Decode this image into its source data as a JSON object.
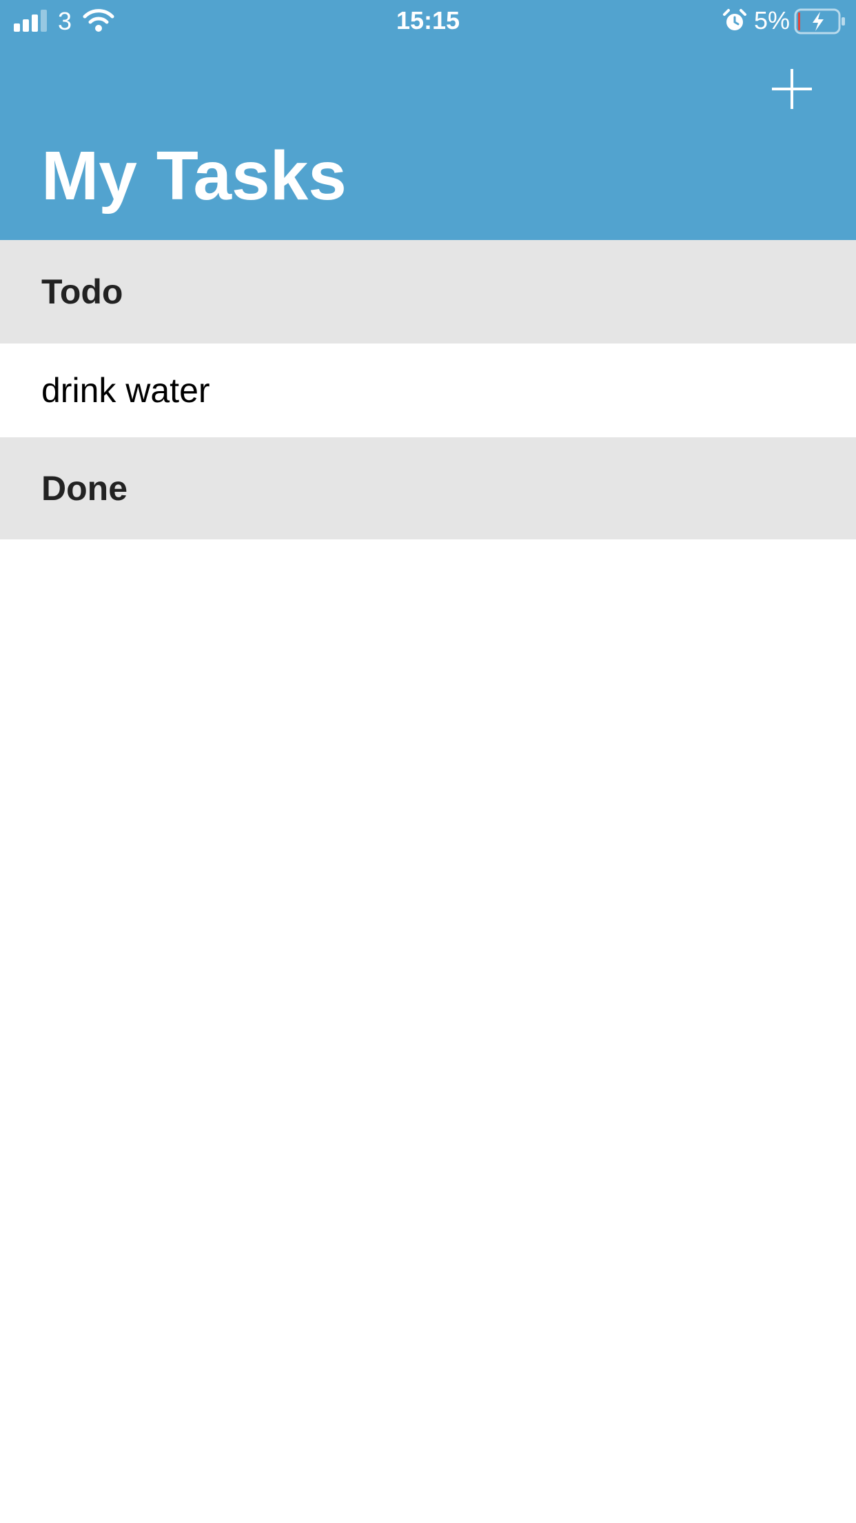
{
  "status_bar": {
    "carrier": "3",
    "time": "15:15",
    "battery_percent": "5%",
    "signal_bars_filled": 3,
    "signal_bars_total": 4,
    "battery_level": 0.05,
    "battery_charging": true,
    "icons": [
      "signal-icon",
      "wifi-icon",
      "alarm-icon",
      "battery-icon",
      "charging-bolt-icon"
    ]
  },
  "header": {
    "title": "My Tasks",
    "add_icon": "plus-icon",
    "background_color": "#52a3cf"
  },
  "sections": [
    {
      "title": "Todo",
      "tasks": [
        "drink water"
      ]
    },
    {
      "title": "Done",
      "tasks": []
    }
  ],
  "colors": {
    "section_header_bg": "#e5e5e5",
    "battery_low": "#e0463c"
  }
}
